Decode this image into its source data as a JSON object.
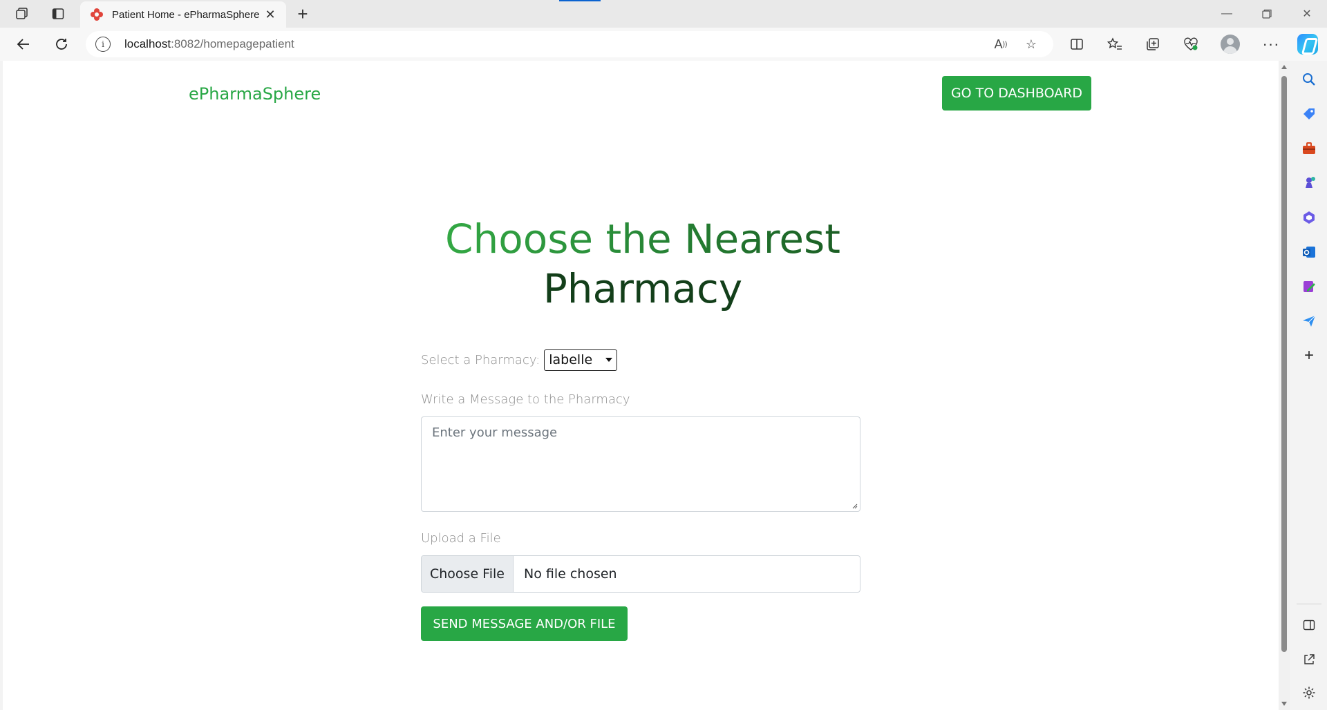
{
  "browser": {
    "tab_title": "Patient Home - ePharmaSphere",
    "url_host": "localhost",
    "url_path": ":8082/homepagepatient",
    "accent": "#0b63d0"
  },
  "page": {
    "brand": "ePharmaSphere",
    "dashboard_button": "GO TO DASHBOARD",
    "hero_line1": "Choose the Nearest",
    "hero_line2": "Pharmacy",
    "select_label": "Select a Pharmacy:",
    "select_value": "labelle",
    "message_label": "Write a Message to the Pharmacy",
    "message_placeholder": "Enter your message",
    "upload_label": "Upload a File",
    "choose_file": "Choose File",
    "no_file": "No file chosen",
    "send_button": "SEND MESSAGE AND/OR FILE",
    "brand_color": "#28a745"
  },
  "icons": {
    "workspaces": "workspaces-icon",
    "tab_actions": "tab-actions-icon",
    "favicon": "red-cross-icon",
    "back": "back-arrow-icon",
    "reload": "reload-icon",
    "info": "info-icon",
    "read_aloud": "read-aloud-icon",
    "favorite": "star-icon",
    "split": "split-screen-icon",
    "favorites": "favorites-icon",
    "collections": "collections-icon",
    "performance": "heartbeat-icon",
    "profile": "profile-avatar",
    "more": "ellipsis-icon",
    "copilot": "copilot-icon"
  }
}
